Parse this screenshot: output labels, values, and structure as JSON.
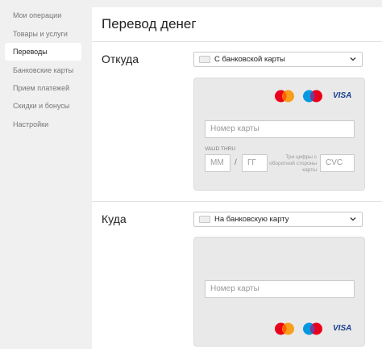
{
  "sidebar": {
    "items": [
      {
        "label": "Мои операции",
        "active": false
      },
      {
        "label": "Товары и услуги",
        "active": false
      },
      {
        "label": "Переводы",
        "active": true
      },
      {
        "label": "Банковские карты",
        "active": false
      },
      {
        "label": "Прием платежей",
        "active": false
      },
      {
        "label": "Скидки и бонусы",
        "active": false
      },
      {
        "label": "Настройки",
        "active": false
      }
    ]
  },
  "main": {
    "title": "Перевод денег",
    "from": {
      "label": "Откуда",
      "source_select": "С банковской карты",
      "card_number_placeholder": "Номер карты",
      "valid_thru_label": "VALID THRU",
      "month_placeholder": "ММ",
      "separator": "/",
      "year_placeholder": "ГГ",
      "cvc_hint": "Три цифры с оборотной стороны карты",
      "cvc_placeholder": "CVC"
    },
    "to": {
      "label": "Куда",
      "target_select": "На банковскую карту",
      "card_number_placeholder": "Номер карты"
    },
    "logos": {
      "mastercard": "MasterCard",
      "maestro": "Maestro",
      "visa": "VISA"
    }
  },
  "colors": {
    "background": "#f0f0f0",
    "panel": "#ffffff",
    "card_bg": "#e9e9e9",
    "mastercard_red": "#eb001b",
    "mastercard_orange": "#f79e1b",
    "maestro_red": "#eb001b",
    "maestro_blue": "#0099df",
    "visa_blue": "#1a3d8f"
  }
}
